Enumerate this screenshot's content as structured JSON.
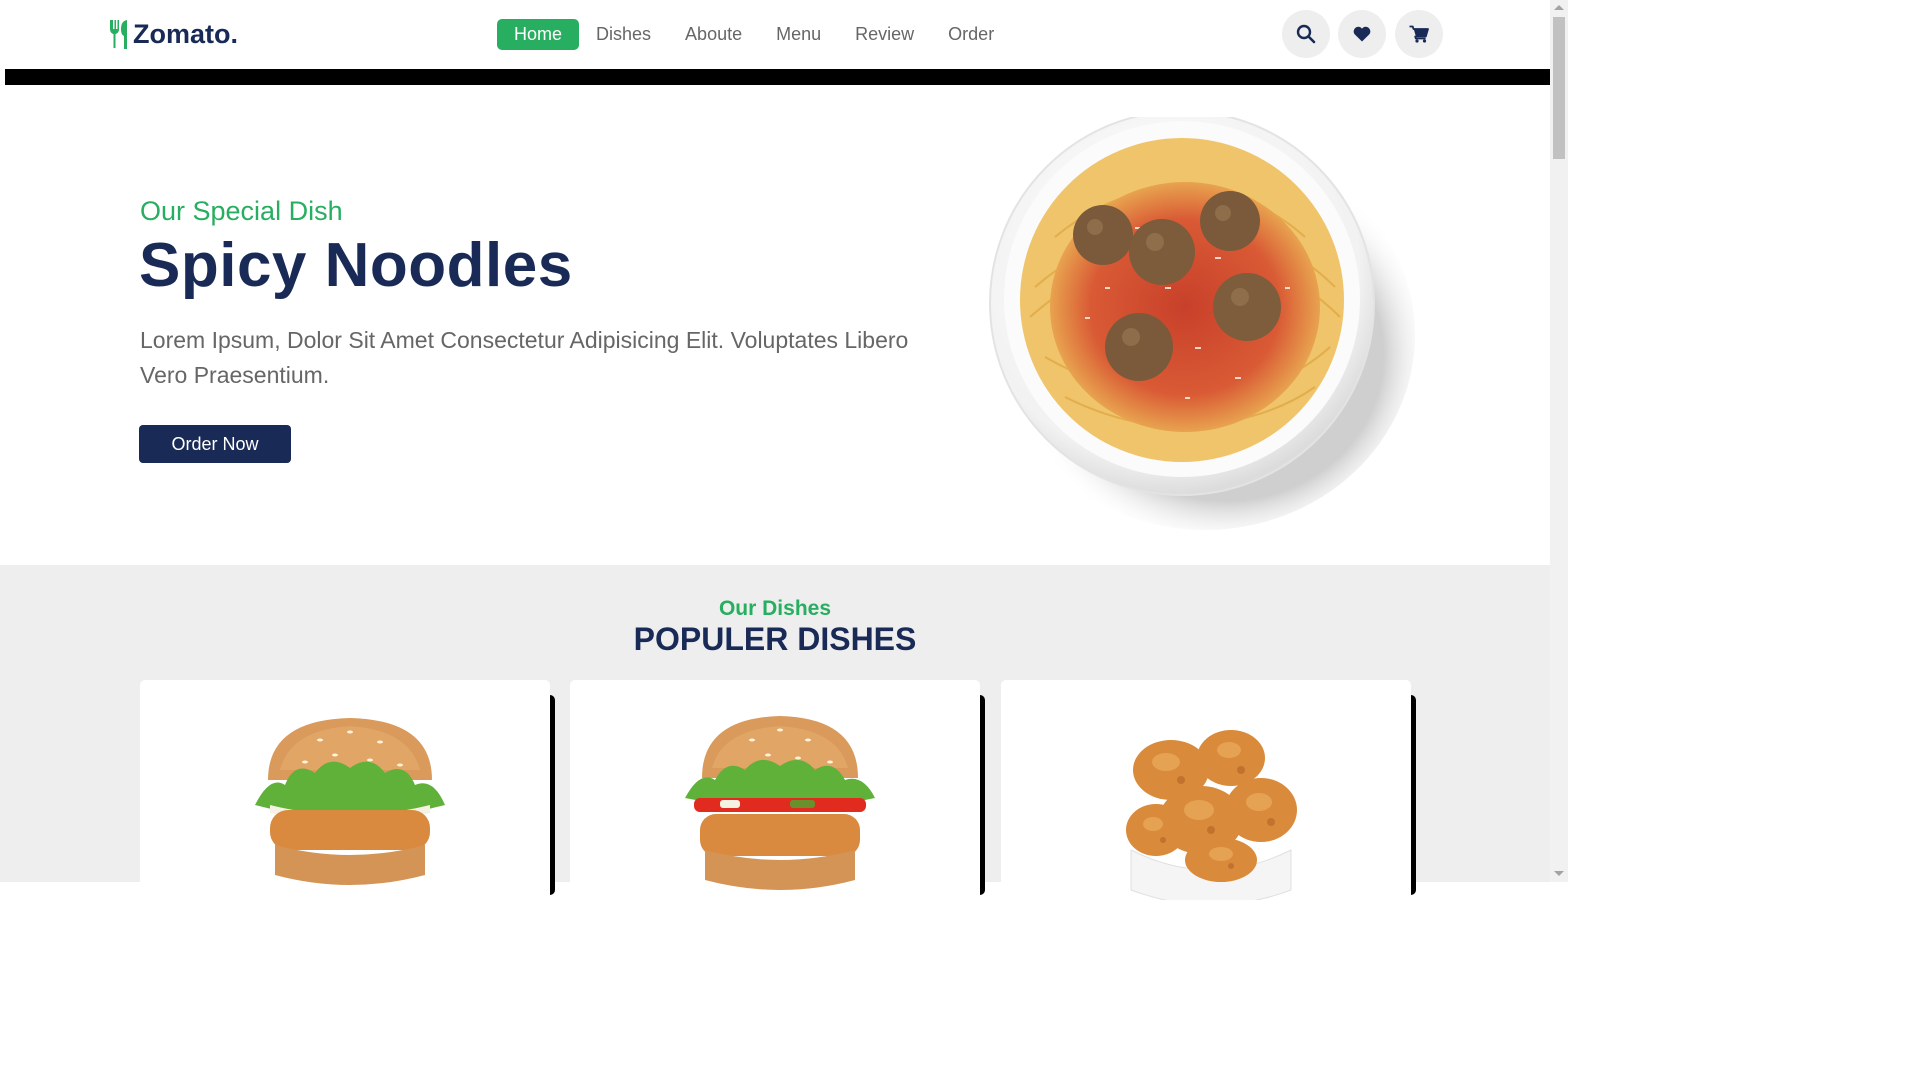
{
  "brand": {
    "name": "Zomato.",
    "logo_icon": "utensils-icon",
    "accent": "#27ae60",
    "primary": "#192a56"
  },
  "nav": {
    "items": [
      {
        "label": "Home",
        "active": true
      },
      {
        "label": "Dishes"
      },
      {
        "label": "Aboute"
      },
      {
        "label": "Menu"
      },
      {
        "label": "Review"
      },
      {
        "label": "Order"
      }
    ]
  },
  "header_icons": [
    "search-icon",
    "heart-icon",
    "cart-icon"
  ],
  "hero": {
    "subtitle": "Our Special Dish",
    "title": "Spicy Noodles",
    "text": "Lorem Ipsum, Dolor Sit Amet Consectetur Adipisicing Elit. Voluptates Libero Vero Praesentium.",
    "button": "Order Now",
    "image": "spaghetti-meatballs-bowl"
  },
  "dishes": {
    "subtitle": "Our Dishes",
    "title": "POPULER DISHES",
    "cards": [
      {
        "image": "chicken-burger"
      },
      {
        "image": "veggie-burger"
      },
      {
        "image": "fried-chicken"
      }
    ]
  }
}
